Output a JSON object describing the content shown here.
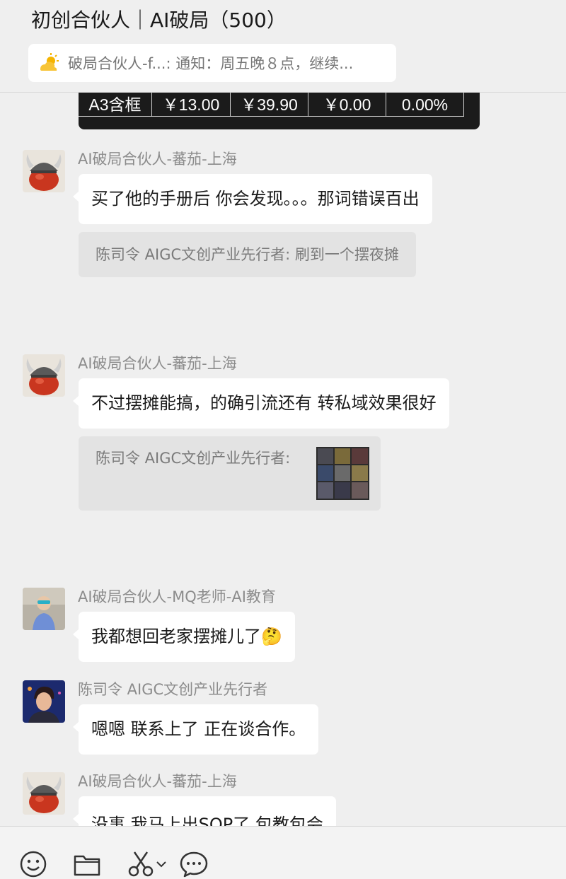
{
  "header": {
    "title": "初创合伙人｜AI破局（500）",
    "notice": "破局合伙人-f...: 通知：周五晚８点，继续..."
  },
  "table_card": {
    "cells": [
      "A3含框",
      "￥13.00",
      "￥39.90",
      "￥0.00",
      "0.00%"
    ]
  },
  "messages": [
    {
      "sender": "AI破局合伙人-蕃茄-上海",
      "text": "买了他的手册后 你会发现。。。那词错误百出",
      "quote": "陈司令 AIGC文创产业先行者: 刷到一个摆夜摊"
    },
    {
      "sender": "AI破局合伙人-蕃茄-上海",
      "text": "不过摆摊能搞，的确引流还有 转私域效果很好",
      "quote": "陈司令 AIGC文创产业先行者:"
    },
    {
      "sender": "AI破局合伙人-MQ老师-AI教育",
      "text": "我都想回老家摆摊儿了",
      "emoji": "🤔"
    },
    {
      "sender": "陈司令 AIGC文创产业先行者",
      "text": "嗯嗯 联系上了 正在谈合作。"
    },
    {
      "sender": "AI破局合伙人-蕃茄-上海",
      "text": "没事 我马上出SOP了 包教包会"
    }
  ],
  "toolbar": {
    "icons": [
      "smiley-icon",
      "folder-icon",
      "scissors-icon",
      "chevron-down-icon",
      "chat-bubble-icon"
    ]
  }
}
